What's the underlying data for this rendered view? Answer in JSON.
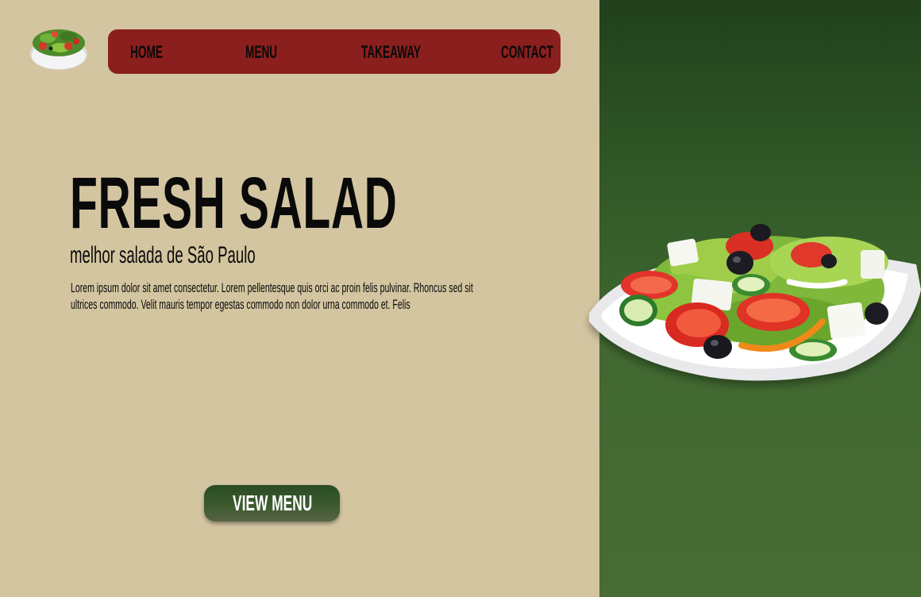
{
  "nav": {
    "items": [
      {
        "label": "HOME"
      },
      {
        "label": "MENU"
      },
      {
        "label": "TAKEAWAY"
      },
      {
        "label": "CONTACT"
      }
    ]
  },
  "hero": {
    "title": "FRESH SALAD",
    "subtitle": "melhor salada de São Paulo",
    "description": "Lorem ipsum dolor sit amet consectetur. Lorem pellentesque quis orci ac proin felis pulvinar. Rhoncus sed sit ultrices commodo. Velit mauris tempor egestas commodo non dolor urna commodo et. Felis"
  },
  "cta": {
    "label": "VIEW MENU"
  },
  "colors": {
    "background": "#d4c5a1",
    "nav_background": "#8b1f1d",
    "panel_green_top": "#21401c",
    "panel_green_bottom": "#496b35",
    "button_green": "#2f5228"
  },
  "images": {
    "logo": "salad-bowl-icon",
    "hero_image": "salad-plate-image"
  }
}
